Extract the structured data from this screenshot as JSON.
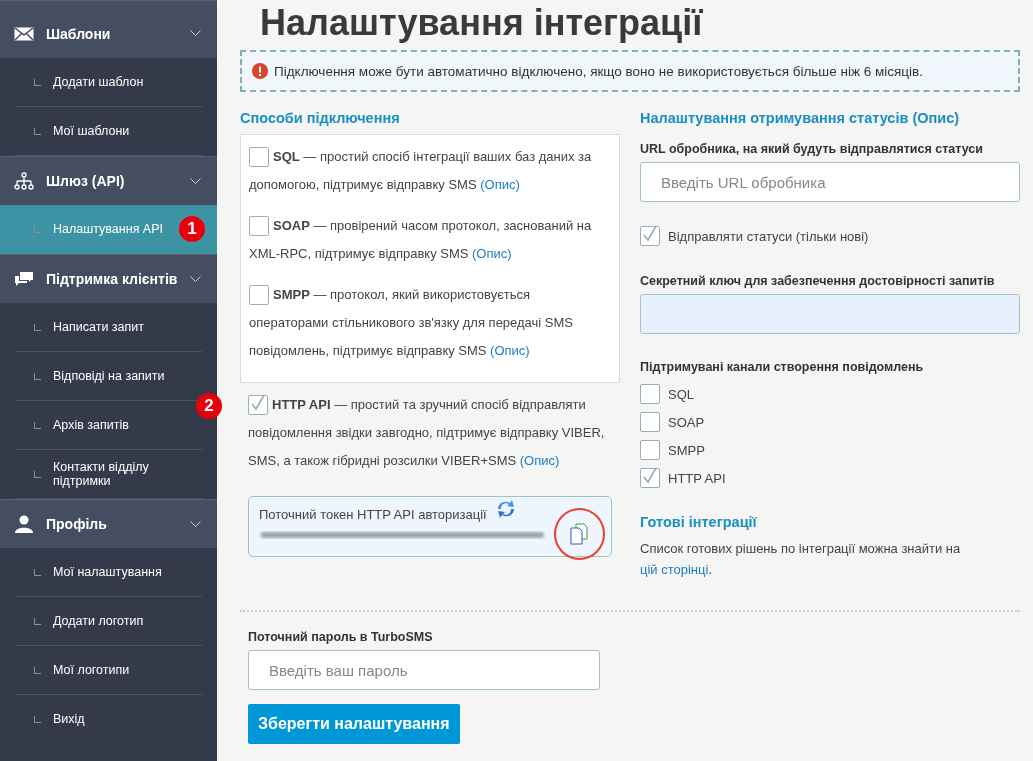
{
  "sidebar": {
    "sections": [
      {
        "title": "Шаблони",
        "expanded": true,
        "items": [
          {
            "label": "Додати шаблон",
            "selected": false
          },
          {
            "label": "Мої шаблони",
            "selected": false
          }
        ]
      },
      {
        "title": "Шлюз (API)",
        "expanded": true,
        "items": [
          {
            "label": "Налаштування API",
            "selected": true,
            "badge": "1"
          }
        ]
      },
      {
        "title": "Підтримка клієнтів",
        "expanded": true,
        "items": [
          {
            "label": "Написати запит",
            "selected": false
          },
          {
            "label": "Відповіді на запити",
            "selected": false
          },
          {
            "label": "Архів запитів",
            "selected": false
          },
          {
            "label": "Контакти відділу підтримки",
            "selected": false
          }
        ]
      },
      {
        "title": "Профіль",
        "expanded": true,
        "items": [
          {
            "label": "Мої налаштування",
            "selected": false
          },
          {
            "label": "Додати логотип",
            "selected": false
          },
          {
            "label": "Мої логотипи",
            "selected": false
          },
          {
            "label": "Вихід",
            "selected": false
          }
        ]
      }
    ]
  },
  "page_title": "Налаштування інтеграції",
  "notice": "Підключення може бути автоматично відключено, якщо воно не використовується більше ніж 6 місяців.",
  "methods": {
    "heading": "Способи підключення",
    "items": [
      {
        "kind": "boxed",
        "name": "SQL",
        "description": " — простий спосіб інтеграції ваших баз даних за допомогою, підтримує відправку SMS ",
        "link": "(Опис)",
        "checked": false
      },
      {
        "kind": "boxed",
        "name": "SOAP",
        "description": " — провірений часом протокол, заснований на XML-RPC, підтримує відправку SMS ",
        "link": "(Опис)",
        "checked": false
      },
      {
        "kind": "boxed",
        "name": "SMPP",
        "description": " — протокол, який використовується операторами стільникового зв'язку для передачі SMS повідомлень, підтримує відправку SMS ",
        "link": "(Опис)",
        "checked": false
      },
      {
        "kind": "plain",
        "name": "HTTP API",
        "description": " — простий та зручний спосіб відправляти повідомлення звідки завгодно, підтримує відправку VIBER, SMS, а також гібридні розсилки VIBER+SMS ",
        "link": "(Опис)",
        "checked": true,
        "badge": "2"
      }
    ]
  },
  "token": {
    "label": "Поточний токен HTTP API авторизації"
  },
  "statuses": {
    "heading": "Налаштування отримування статусів (Опис)",
    "url_label": "URL обробника, на який будуть відправлятися статуси",
    "url_placeholder": "Введіть URL обробника",
    "send_label": "Відправляти статуси (тільки нові)",
    "send_checked": true,
    "secret_label": "Секретний ключ для забезпечення достовірності запитів",
    "channels_label": "Підтримувані канали створення повідомлень",
    "channels": [
      {
        "label": "SQL",
        "checked": false
      },
      {
        "label": "SOAP",
        "checked": false
      },
      {
        "label": "SMPP",
        "checked": false
      },
      {
        "label": "HTTP API",
        "checked": true
      }
    ]
  },
  "ready": {
    "heading": "Готові інтеграції",
    "text": "Список готових рішень по інтеграції можна знайти на ",
    "link": "цій сторінці",
    "end": "."
  },
  "password": {
    "label": "Поточний пароль в TurboSMS",
    "placeholder": "Введіть ваш пароль"
  },
  "save_button": "Зберегти налаштування"
}
